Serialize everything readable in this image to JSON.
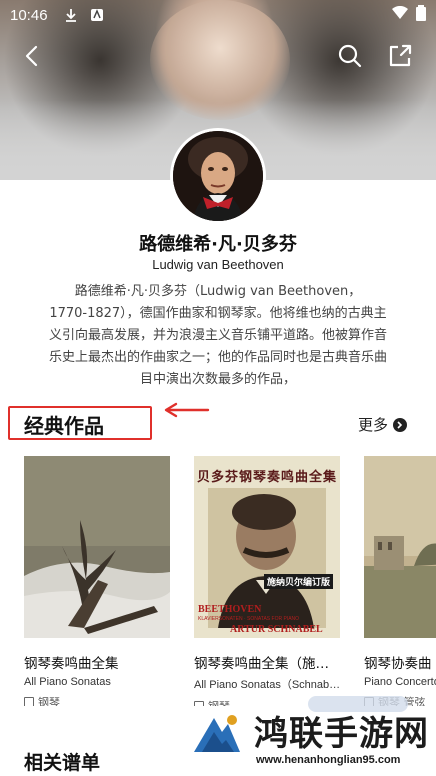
{
  "status_bar": {
    "time": "10:46"
  },
  "composer": {
    "name_cn": "路德维希·凡·贝多芬",
    "name_en": "Ludwig van Beethoven",
    "bio_lines": [
      "路德维希·凡·贝多芬（Ludwig van Beethoven，",
      "1770-1827），德国作曲家和钢琴家。他将维也纳的古典主",
      "义引向最高发展，并为浪漫主义音乐铺平道路。他被算作音",
      "乐史上最杰出的作曲家之一；他的作品同时也是古典音乐曲",
      "目中演出次数最多的作品，"
    ]
  },
  "classic_works": {
    "title": "经典作品",
    "more_label": "更多",
    "items": [
      {
        "title": "钢琴奏鸣曲全集",
        "subtitle": "All Piano Sonatas",
        "instrument": "钢琴"
      },
      {
        "title": "钢琴奏鸣曲全集（施…",
        "subtitle": "All Piano Sonatas（Schnab…",
        "instrument": "钢琴",
        "cover_text": {
          "top": "贝多芬钢琴奏鸣曲全集",
          "stamp": "施纳贝尔编订版",
          "bottom1": "BEETHOVEN",
          "bottom2": "KLAVIERSONATEN · SONATAS FOR PIANO",
          "bottom3": "ARTUR SCHNABEL"
        }
      },
      {
        "title": "钢琴协奏曲",
        "subtitle": "Piano Concerto",
        "instrument": "钢琴 管弦"
      }
    ]
  },
  "related_scores": {
    "title": "相关谱单"
  },
  "watermark": {
    "brand": "鸿联手游网",
    "url": "www.henanhonglian95.com"
  },
  "colors": {
    "annotation_red": "#e0302b"
  }
}
